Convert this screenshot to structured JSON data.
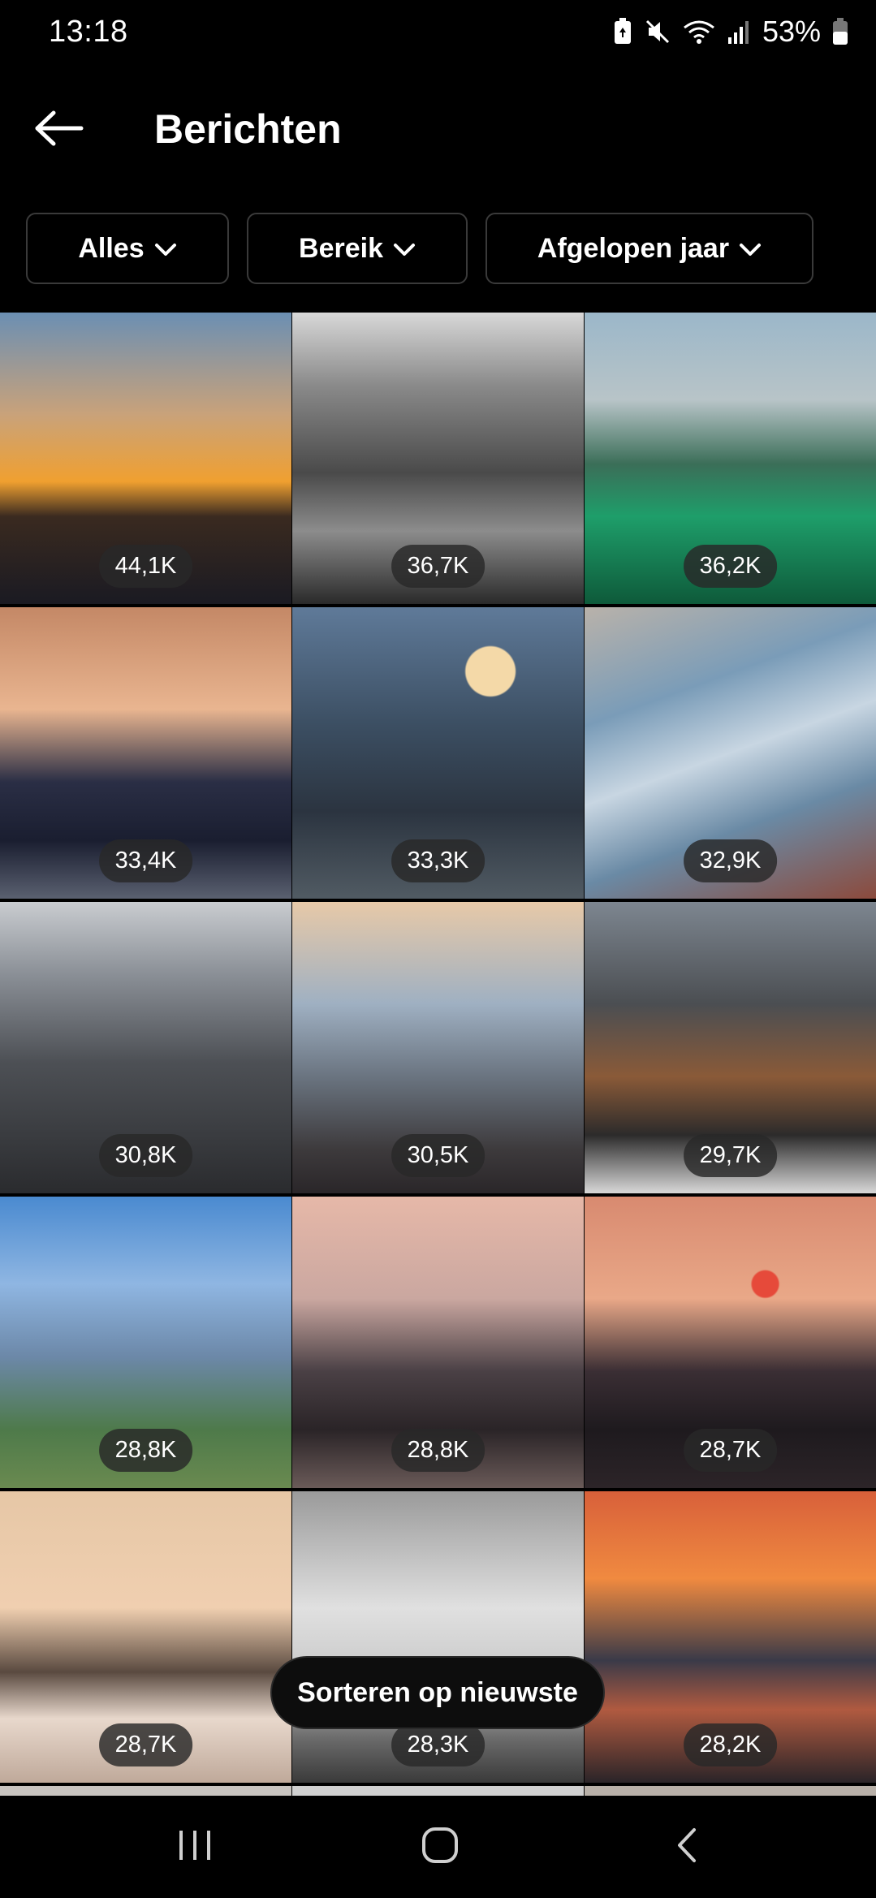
{
  "status_bar": {
    "time": "13:18",
    "battery": "53%",
    "icons": [
      "battery-saver-icon",
      "mute-icon",
      "wifi-icon",
      "signal-icon",
      "battery-icon"
    ]
  },
  "header": {
    "title": "Berichten",
    "back_icon": "arrow-left-icon"
  },
  "filters": [
    {
      "label": "Alles",
      "icon": "chevron-down-icon"
    },
    {
      "label": "Bereik",
      "icon": "chevron-down-icon"
    },
    {
      "label": "Afgelopen jaar",
      "icon": "chevron-down-icon"
    }
  ],
  "posts": [
    {
      "reach": "44,1K"
    },
    {
      "reach": "36,7K"
    },
    {
      "reach": "36,2K"
    },
    {
      "reach": "33,4K"
    },
    {
      "reach": "33,3K"
    },
    {
      "reach": "32,9K"
    },
    {
      "reach": "30,8K"
    },
    {
      "reach": "30,5K"
    },
    {
      "reach": "29,7K"
    },
    {
      "reach": "28,8K"
    },
    {
      "reach": "28,8K"
    },
    {
      "reach": "28,7K"
    },
    {
      "reach": "28,7K"
    },
    {
      "reach": "28,3K"
    },
    {
      "reach": "28,2K"
    }
  ],
  "sort_button": {
    "label": "Sorteren op nieuwste"
  },
  "nav_bar": {
    "icons": [
      "recents-icon",
      "home-icon",
      "back-icon"
    ]
  }
}
